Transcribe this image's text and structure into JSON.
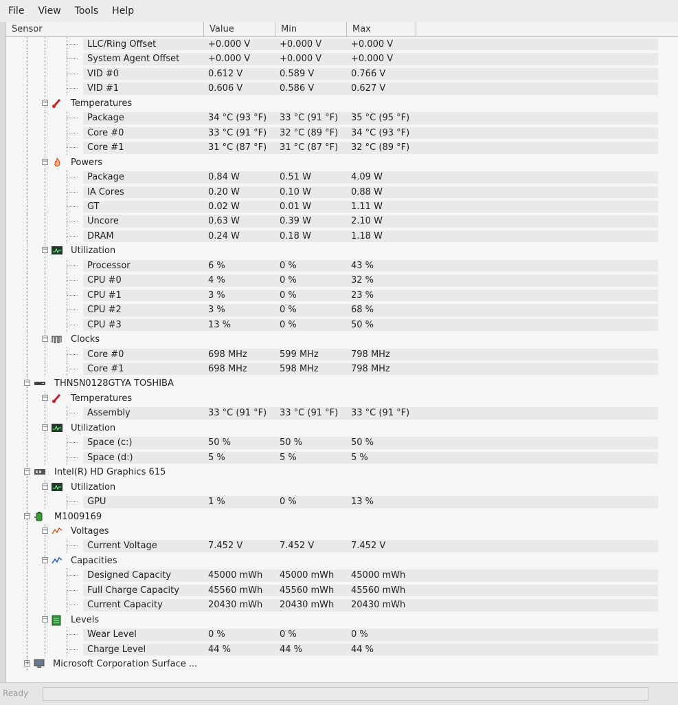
{
  "menu": [
    "File",
    "View",
    "Tools",
    "Help"
  ],
  "columns": {
    "sensor": "Sensor",
    "value": "Value",
    "min": "Min",
    "max": "Max"
  },
  "rows": [
    {
      "level": 3,
      "label": "LLC/Ring Offset",
      "value": "+0.000 V",
      "min": "+0.000 V",
      "max": "+0.000 V"
    },
    {
      "level": 3,
      "label": "System Agent Offset",
      "value": "+0.000 V",
      "min": "+0.000 V",
      "max": "+0.000 V"
    },
    {
      "level": 3,
      "label": "VID #0",
      "value": "0.612 V",
      "min": "0.589 V",
      "max": "0.766 V"
    },
    {
      "level": 3,
      "label": "VID #1",
      "value": "0.606 V",
      "min": "0.586 V",
      "max": "0.627 V"
    },
    {
      "level": 2,
      "group": true,
      "icon": "thermometer-icon",
      "label": "Temperatures"
    },
    {
      "level": 3,
      "label": "Package",
      "value": "34 °C  (93 °F)",
      "min": "33 °C  (91 °F)",
      "max": "35 °C  (95 °F)"
    },
    {
      "level": 3,
      "label": "Core #0",
      "value": "33 °C  (91 °F)",
      "min": "32 °C  (89 °F)",
      "max": "34 °C  (93 °F)"
    },
    {
      "level": 3,
      "label": "Core #1",
      "value": "31 °C  (87 °F)",
      "min": "31 °C  (87 °F)",
      "max": "32 °C  (89 °F)"
    },
    {
      "level": 2,
      "group": true,
      "icon": "flame-icon",
      "label": "Powers"
    },
    {
      "level": 3,
      "label": "Package",
      "value": "0.84 W",
      "min": "0.51 W",
      "max": "4.09 W"
    },
    {
      "level": 3,
      "label": "IA Cores",
      "value": "0.20 W",
      "min": "0.10 W",
      "max": "0.88 W"
    },
    {
      "level": 3,
      "label": "GT",
      "value": "0.02 W",
      "min": "0.01 W",
      "max": "1.11 W"
    },
    {
      "level": 3,
      "label": "Uncore",
      "value": "0.63 W",
      "min": "0.39 W",
      "max": "2.10 W"
    },
    {
      "level": 3,
      "label": "DRAM",
      "value": "0.24 W",
      "min": "0.18 W",
      "max": "1.18 W"
    },
    {
      "level": 2,
      "group": true,
      "icon": "utilization-icon",
      "label": "Utilization"
    },
    {
      "level": 3,
      "label": "Processor",
      "value": "6 %",
      "min": "0 %",
      "max": "43 %"
    },
    {
      "level": 3,
      "label": "CPU #0",
      "value": "4 %",
      "min": "0 %",
      "max": "32 %"
    },
    {
      "level": 3,
      "label": "CPU #1",
      "value": "3 %",
      "min": "0 %",
      "max": "23 %"
    },
    {
      "level": 3,
      "label": "CPU #2",
      "value": "3 %",
      "min": "0 %",
      "max": "68 %"
    },
    {
      "level": 3,
      "label": "CPU #3",
      "value": "13 %",
      "min": "0 %",
      "max": "50 %"
    },
    {
      "level": 2,
      "group": true,
      "icon": "clock-icon",
      "label": "Clocks"
    },
    {
      "level": 3,
      "label": "Core #0",
      "value": "698 MHz",
      "min": "599 MHz",
      "max": "798 MHz"
    },
    {
      "level": 3,
      "label": "Core #1",
      "value": "698 MHz",
      "min": "598 MHz",
      "max": "798 MHz"
    },
    {
      "level": 1,
      "group": true,
      "icon": "drive-icon",
      "label": "THNSN0128GTYA TOSHIBA"
    },
    {
      "level": 2,
      "group": true,
      "icon": "thermometer-icon",
      "label": "Temperatures"
    },
    {
      "level": 3,
      "label": "Assembly",
      "value": "33 °C  (91 °F)",
      "min": "33 °C  (91 °F)",
      "max": "33 °C  (91 °F)"
    },
    {
      "level": 2,
      "group": true,
      "icon": "utilization-icon",
      "label": "Utilization"
    },
    {
      "level": 3,
      "label": "Space (c:)",
      "value": "50 %",
      "min": "50 %",
      "max": "50 %"
    },
    {
      "level": 3,
      "label": "Space (d:)",
      "value": "5 %",
      "min": "5 %",
      "max": "5 %"
    },
    {
      "level": 1,
      "group": true,
      "icon": "gpu-icon",
      "label": "Intel(R) HD Graphics 615"
    },
    {
      "level": 2,
      "group": true,
      "icon": "utilization-icon",
      "label": "Utilization"
    },
    {
      "level": 3,
      "label": "GPU",
      "value": "1 %",
      "min": "0 %",
      "max": "13 %"
    },
    {
      "level": 1,
      "group": true,
      "icon": "battery-icon",
      "label": "M1009169"
    },
    {
      "level": 2,
      "group": true,
      "icon": "voltage-icon",
      "label": "Voltages"
    },
    {
      "level": 3,
      "label": "Current Voltage",
      "value": "7.452 V",
      "min": "7.452 V",
      "max": "7.452 V"
    },
    {
      "level": 2,
      "group": true,
      "icon": "capacity-icon",
      "label": "Capacities"
    },
    {
      "level": 3,
      "label": "Designed Capacity",
      "value": "45000 mWh",
      "min": "45000 mWh",
      "max": "45000 mWh"
    },
    {
      "level": 3,
      "label": "Full Charge Capacity",
      "value": "45560 mWh",
      "min": "45560 mWh",
      "max": "45560 mWh"
    },
    {
      "level": 3,
      "label": "Current Capacity",
      "value": "20430 mWh",
      "min": "20430 mWh",
      "max": "20430 mWh"
    },
    {
      "level": 2,
      "group": true,
      "icon": "levels-icon",
      "label": "Levels"
    },
    {
      "level": 3,
      "label": "Wear Level",
      "value": "0 %",
      "min": "0 %",
      "max": "0 %"
    },
    {
      "level": 3,
      "label": "Charge Level",
      "value": "44 %",
      "min": "44 %",
      "max": "44 %"
    },
    {
      "level": 0,
      "group": true,
      "collapsed": true,
      "icon": "computer-icon",
      "label": "Microsoft Corporation Surface ..."
    }
  ],
  "status": "Ready"
}
